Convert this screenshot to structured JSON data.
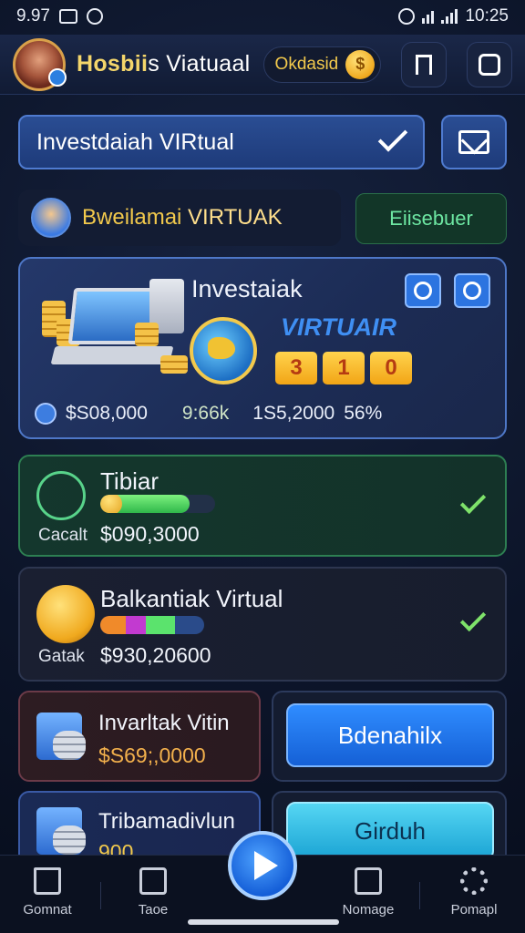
{
  "status_bar": {
    "time_left": "9.97",
    "time_right": "10:25"
  },
  "header": {
    "title_gold": "Hosbii",
    "title_white": "s Viatuaal",
    "coin_label": "Okdasid",
    "coin_symbol": "$"
  },
  "dropdown": {
    "label": "Investdaiah VIRtual"
  },
  "user": {
    "name_a": "Bweilamai",
    "name_b": " VIRTUAK",
    "action_label": "Eiisebuer"
  },
  "main_card": {
    "title": "Investaiak",
    "subtitle": "VIRTUAIR",
    "digits": [
      "3",
      "1",
      "0"
    ],
    "stats": [
      "$S08,000",
      "9:66k",
      "1S5,2000",
      "56%"
    ]
  },
  "row_green": {
    "title": "Tibiar",
    "label": "Cacalt",
    "amount": "$090,3000",
    "progress": 0.78
  },
  "row_dark": {
    "title": "Balkantiak Virtual",
    "label": "Gatak",
    "amount": "$930,20600",
    "progress": 0.72
  },
  "grid": {
    "card1": {
      "title": "Invarltak Vitin",
      "amount": "$S69;,0000"
    },
    "card2": {
      "button": "Bdenahilx"
    },
    "card3": {
      "title": "Tribamadivlun",
      "amount": "900"
    },
    "card4": {
      "button": "Girduh"
    }
  },
  "nav": {
    "items": [
      "Gomnat",
      "Taoe",
      "Nomage",
      "Pomapl"
    ]
  },
  "colors": {
    "accent_blue": "#2c74e0",
    "accent_gold": "#f2c94c",
    "accent_green": "#2fb84a"
  }
}
